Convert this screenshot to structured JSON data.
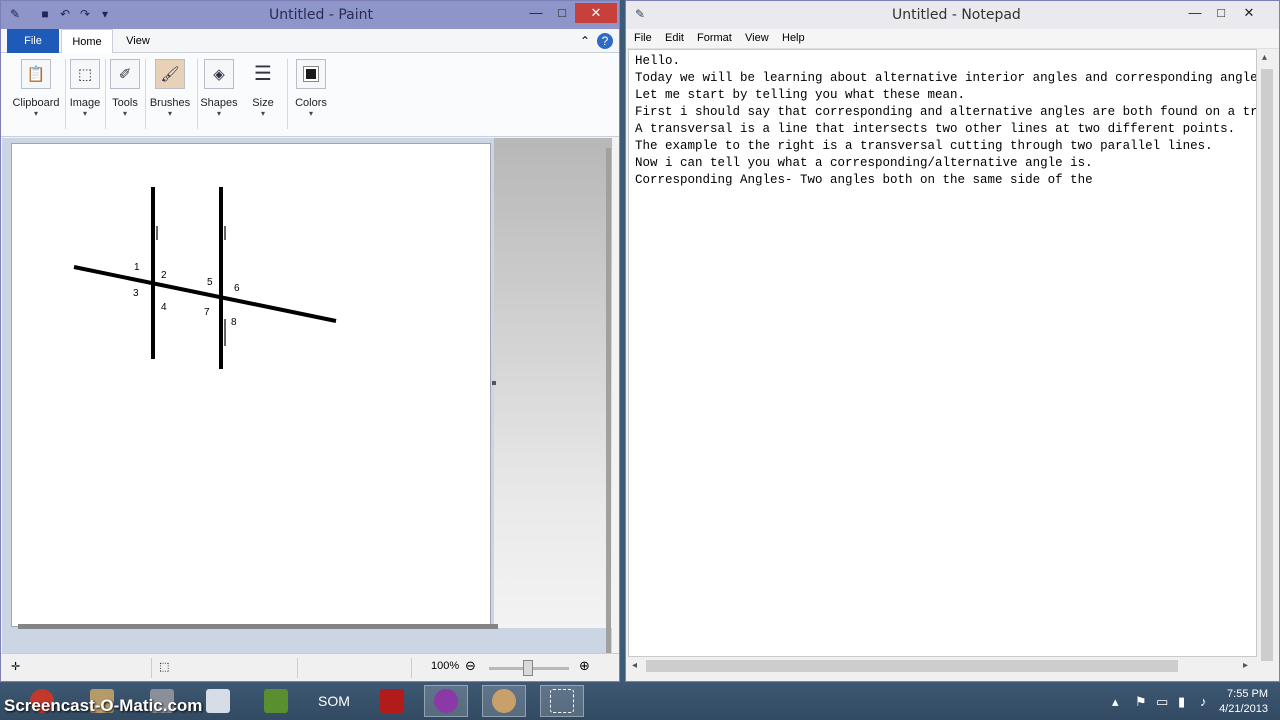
{
  "paint": {
    "title": "Untitled - Paint",
    "tabs": {
      "file": "File",
      "home": "Home",
      "view": "View"
    },
    "groups": [
      {
        "label": "Clipboard",
        "icon": "clipboard-icon"
      },
      {
        "label": "Image",
        "icon": "image-select-icon"
      },
      {
        "label": "Tools",
        "icon": "tools-icon"
      },
      {
        "label": "Brushes",
        "icon": "brush-icon"
      },
      {
        "label": "Shapes",
        "icon": "shapes-icon"
      },
      {
        "label": "Size",
        "icon": "size-lines-icon"
      },
      {
        "label": "Colors",
        "icon": "color-palette-icon"
      }
    ],
    "angle_labels": [
      "1",
      "2",
      "3",
      "4",
      "5",
      "6",
      "7",
      "8"
    ],
    "status": {
      "zoom": "100%"
    }
  },
  "notepad": {
    "title": "Untitled - Notepad",
    "menu": [
      "File",
      "Edit",
      "Format",
      "View",
      "Help"
    ],
    "lines": [
      "Hello.",
      "Today we will be learning about alternative interior angles and corresponding angles.",
      "Let me start by telling you what these mean.",
      "First i should say that corresponding and alternative angles are both found on a transversal.",
      "A transversal is a line that intersects two other lines at two different points.",
      "The example to the right is a transversal cutting through two parallel lines.",
      "Now i can tell you what a corresponding/alternative angle is.",
      "Corresponding Angles- Two angles both on the same side of the"
    ]
  },
  "taskbar": {
    "watermark": "Screencast-O-Matic.com",
    "som_label": "SOM",
    "time": "7:55 PM",
    "date": "4/21/2013"
  }
}
